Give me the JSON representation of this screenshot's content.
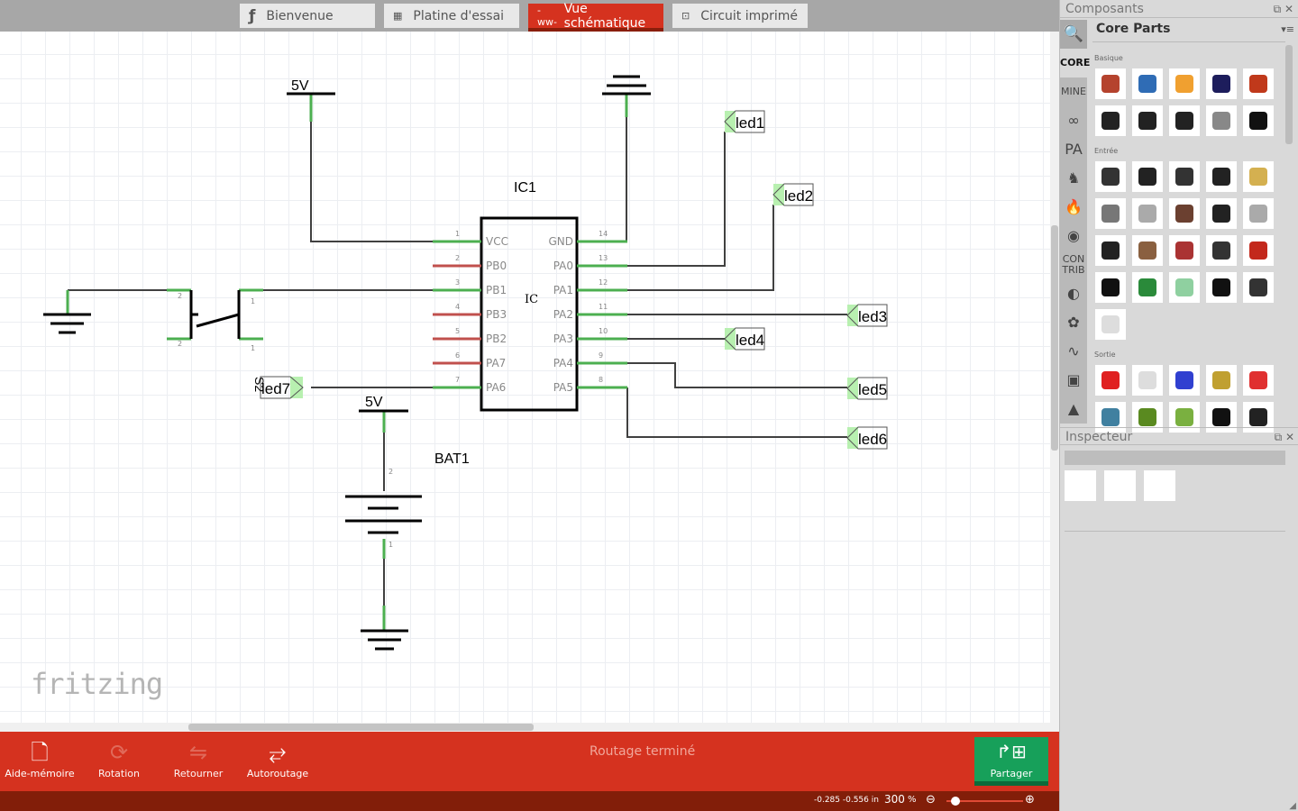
{
  "tabs": [
    {
      "label": "Bienvenue",
      "icon": "fritzing-f-icon",
      "active": false
    },
    {
      "label": "Platine d'essai",
      "icon": "breadboard-icon",
      "active": false
    },
    {
      "label": "Vue schématique",
      "icon": "schematic-icon",
      "active": true
    },
    {
      "label": "Circuit imprimé",
      "icon": "pcb-icon",
      "active": false
    }
  ],
  "schematic": {
    "ic_label": "IC1",
    "ic_body": "IC",
    "left_pins": [
      {
        "n": "1",
        "name": "VCC",
        "connected": true
      },
      {
        "n": "2",
        "name": "PB0",
        "connected": false
      },
      {
        "n": "3",
        "name": "PB1",
        "connected": true
      },
      {
        "n": "4",
        "name": "PB3",
        "connected": false
      },
      {
        "n": "5",
        "name": "PB2",
        "connected": false
      },
      {
        "n": "6",
        "name": "PA7",
        "connected": false
      },
      {
        "n": "7",
        "name": "PA6",
        "connected": true
      }
    ],
    "right_pins": [
      {
        "n": "14",
        "name": "GND"
      },
      {
        "n": "13",
        "name": "PA0"
      },
      {
        "n": "12",
        "name": "PA1"
      },
      {
        "n": "11",
        "name": "PA2"
      },
      {
        "n": "10",
        "name": "PA3"
      },
      {
        "n": "9",
        "name": "PA4"
      },
      {
        "n": "8",
        "name": "PA5"
      }
    ],
    "net_labels": [
      "led1",
      "led2",
      "led3",
      "led4",
      "led5",
      "led6",
      "led7"
    ],
    "power_label_top": "5V",
    "power_label_bat": "5V",
    "battery_label": "BAT1",
    "battery_pins": [
      "2",
      "1"
    ],
    "switch_label": "S2",
    "switch_pins": [
      "2",
      "2",
      "1",
      "1"
    ]
  },
  "logo": "fritzing",
  "toolbar": {
    "buttons": [
      {
        "label": "Aide-mémoire",
        "icon": "note-icon"
      },
      {
        "label": "Rotation",
        "icon": "rotate-icon"
      },
      {
        "label": "Retourner",
        "icon": "flip-icon"
      },
      {
        "label": "Autoroutage",
        "icon": "autoroute-icon"
      }
    ],
    "status": "Routage terminé",
    "share": "Partager"
  },
  "statusbar": {
    "coords": "-0.285 -0.556 in",
    "zoom": "300",
    "zoom_unit": "%",
    "zoom_level_fraction": 0.05
  },
  "parts": {
    "title": "Composants",
    "bin_title": "Core Parts",
    "bins": [
      "CORE",
      "MINE",
      "arduino",
      "PA",
      "seeed",
      "sparkfun",
      "snootlab",
      "CON TRIB",
      "dfrobot",
      "lilypad",
      "analog",
      "intel",
      "scroll"
    ],
    "sections": [
      {
        "title": "Basique",
        "items": [
          "resistor",
          "ceramic-capacitor",
          "tantalum-capacitor",
          "electrolytic-capacitor",
          "inductor",
          "diode",
          "pnp-transistor",
          "npn-transistor",
          "fet-p",
          "mystery-part"
        ]
      },
      {
        "title": "Entrée",
        "items": [
          "potentiometer",
          "slide-potentiometer",
          "slide-switch",
          "dip-switch",
          "piezo",
          "rotary-encoder",
          "reed-switch",
          "pushbutton",
          "toggle-switch",
          "tilt-switch",
          "fsr",
          "flex-sensor",
          "photocell",
          "distance-sensor",
          "accelerometer",
          "temperature-sensor",
          "board",
          "reed",
          "microphone",
          "rfid",
          "dht-sensor"
        ]
      },
      {
        "title": "Sortie",
        "items": [
          "red-led",
          "rgb-led",
          "blue-led",
          "power-led",
          "seven-segment",
          "led-matrix",
          "lcd",
          "lcd2",
          "buzzer",
          "speaker"
        ]
      }
    ]
  },
  "inspector": {
    "title": "Inspecteur"
  },
  "colors": {
    "accent": "#d5321f",
    "dark_accent": "#821e09",
    "share": "#17a05a",
    "wire": "#404040",
    "pin_ok": "#4caf50",
    "pin_open": "#c0504d"
  }
}
